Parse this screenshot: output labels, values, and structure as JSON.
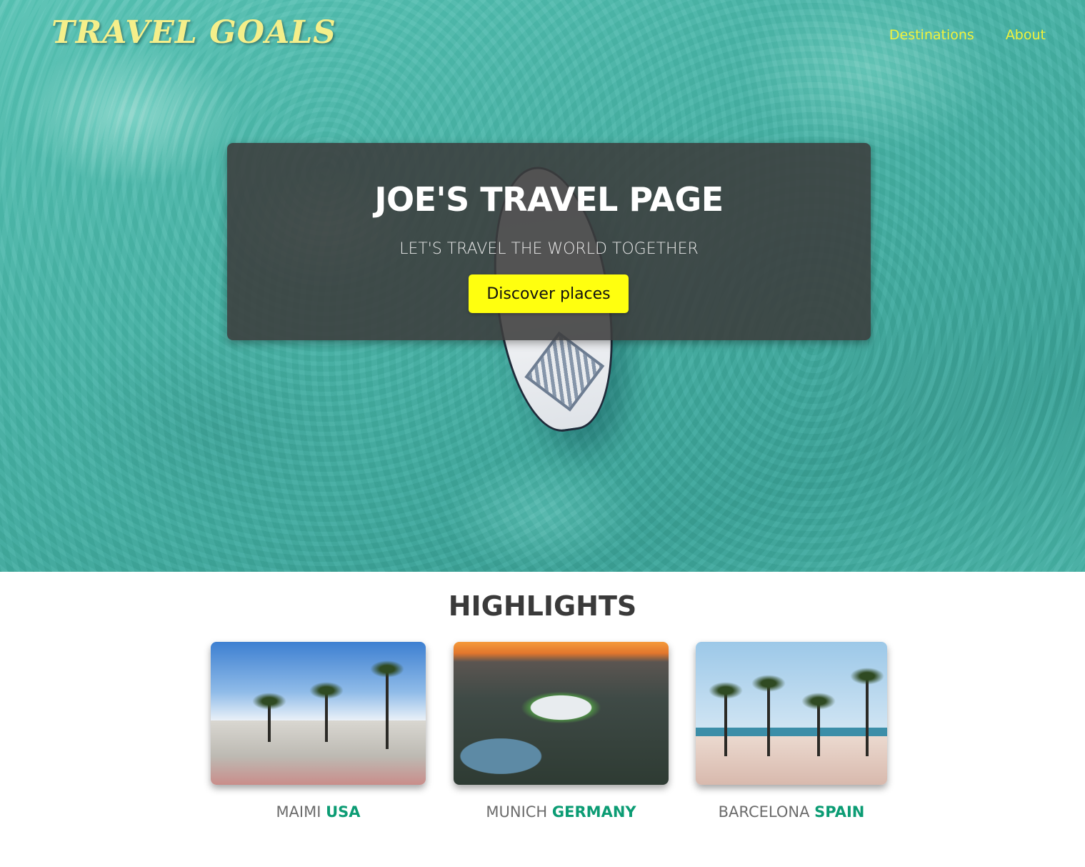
{
  "header": {
    "logo": "TRAVEL GOALS",
    "nav": [
      {
        "label": "Destinations"
      },
      {
        "label": "About"
      }
    ]
  },
  "hero": {
    "title": "JOE'S TRAVEL PAGE",
    "subtitle": "LET'S TRAVEL THE WORLD TOGETHER",
    "button_label": "Discover places"
  },
  "highlights": {
    "title": "HIGHLIGHTS",
    "cards": [
      {
        "city": "MAIMI",
        "country": "USA"
      },
      {
        "city": "MUNICH",
        "country": "GERMANY"
      },
      {
        "city": "BARCELONA",
        "country": "SPAIN"
      }
    ]
  },
  "colors": {
    "nav_link": "#f2f23a",
    "logo": "#f5ef8a",
    "button_bg": "#ffff0f",
    "country_accent": "#0c9c74"
  }
}
